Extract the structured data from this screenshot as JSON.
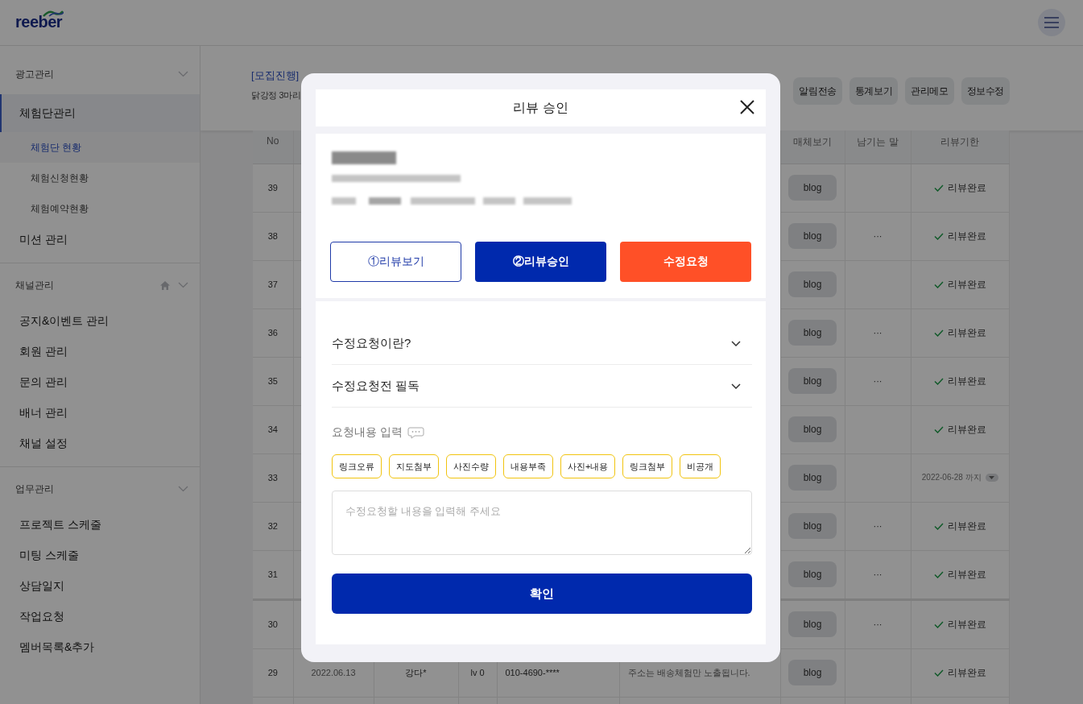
{
  "header": {
    "logo": "reeber"
  },
  "sidebar": {
    "sections": [
      {
        "title": "광고관리",
        "home": false,
        "expanded": false,
        "items": [
          {
            "label": "체험단관리",
            "selected": true,
            "children": [
              {
                "label": "체험단 현황",
                "selected": true
              },
              {
                "label": "체험신청현황",
                "selected": false
              },
              {
                "label": "체험예약현황",
                "selected": false
              }
            ]
          },
          {
            "label": "미션 관리",
            "selected": false
          }
        ]
      },
      {
        "title": "채널관리",
        "home": true,
        "expanded": false,
        "items": [
          {
            "label": "공지&이벤트 관리",
            "selected": false
          },
          {
            "label": "회원 관리",
            "selected": false
          },
          {
            "label": "문의 관리",
            "selected": false
          },
          {
            "label": "배너 관리",
            "selected": false
          },
          {
            "label": "채널 설정",
            "selected": false
          }
        ]
      },
      {
        "title": "업무관리",
        "home": false,
        "expanded": false,
        "items": [
          {
            "label": "프로젝트 스케줄",
            "selected": false
          },
          {
            "label": "미팅 스케줄",
            "selected": false
          },
          {
            "label": "상담일지",
            "selected": false
          },
          {
            "label": "작업요청",
            "selected": false
          },
          {
            "label": "멤버목록&추가",
            "selected": false
          }
        ]
      }
    ]
  },
  "page": {
    "status": "[모집진행]",
    "subtitle": "닭강정 3마리",
    "actions": [
      "알림전송",
      "통계보기",
      "관리메모",
      "정보수정"
    ]
  },
  "table": {
    "columns": [
      "No",
      "",
      "",
      "",
      "",
      "",
      "매체보기",
      "남기는 말",
      "리뷰기한"
    ],
    "rows": [
      {
        "no": "39",
        "media": "blog",
        "comment": "",
        "deadline": {
          "kind": "done",
          "text": "리뷰완료"
        }
      },
      {
        "no": "38",
        "media": "blog",
        "comment": "···",
        "deadline": {
          "kind": "done",
          "text": "리뷰완료"
        }
      },
      {
        "no": "37",
        "media": "blog",
        "comment": "",
        "deadline": {
          "kind": "done",
          "text": "리뷰완료"
        }
      },
      {
        "no": "36",
        "media": "blog",
        "comment": "···",
        "deadline": {
          "kind": "done",
          "text": "리뷰완료"
        }
      },
      {
        "no": "35",
        "media": "blog",
        "comment": "···",
        "deadline": {
          "kind": "done",
          "text": "리뷰완료"
        }
      },
      {
        "no": "34",
        "media": "blog",
        "comment": "",
        "deadline": {
          "kind": "done",
          "text": "리뷰완료"
        }
      },
      {
        "no": "33",
        "media": "blog",
        "comment": "",
        "deadline": {
          "kind": "date",
          "text": "2022-06-28 까지"
        }
      },
      {
        "no": "32",
        "media": "blog",
        "comment": "···",
        "deadline": {
          "kind": "done",
          "text": "리뷰완료"
        }
      },
      {
        "no": "31",
        "media": "blog",
        "comment": "···",
        "deadline": {
          "kind": "done",
          "text": "리뷰완료"
        }
      },
      {
        "no": "30",
        "media": "blog",
        "comment": "···",
        "deadline": {
          "kind": "done",
          "text": "리뷰완료"
        }
      },
      {
        "no": "29",
        "date": "2022.06.13",
        "name": "강다*",
        "level": "lv 0",
        "phone": "010-4690-****",
        "note": "주소는 배송체험만 노출됩니다.",
        "media": "blog",
        "comment": "",
        "deadline": {
          "kind": "done",
          "text": "리뷰완료"
        }
      }
    ]
  },
  "modal": {
    "title": "리뷰 승인",
    "buttons": [
      {
        "label": "①리뷰보기",
        "kind": "outline"
      },
      {
        "label": "②리뷰승인",
        "kind": "primary"
      },
      {
        "label": "수정요청",
        "kind": "warning"
      }
    ],
    "accordions": [
      {
        "label": "수정요청이란?",
        "expanded": false
      },
      {
        "label": "수정요청전 필독",
        "expanded": false
      }
    ],
    "input_label": "요청내용 입력",
    "chips": [
      "링크오류",
      "지도첨부",
      "사진수량",
      "내용부족",
      "사진+내용",
      "링크첨부",
      "비공개"
    ],
    "textarea": {
      "placeholder": "수정요청할 내용을 입력해 주세요"
    },
    "confirm": "확인"
  }
}
